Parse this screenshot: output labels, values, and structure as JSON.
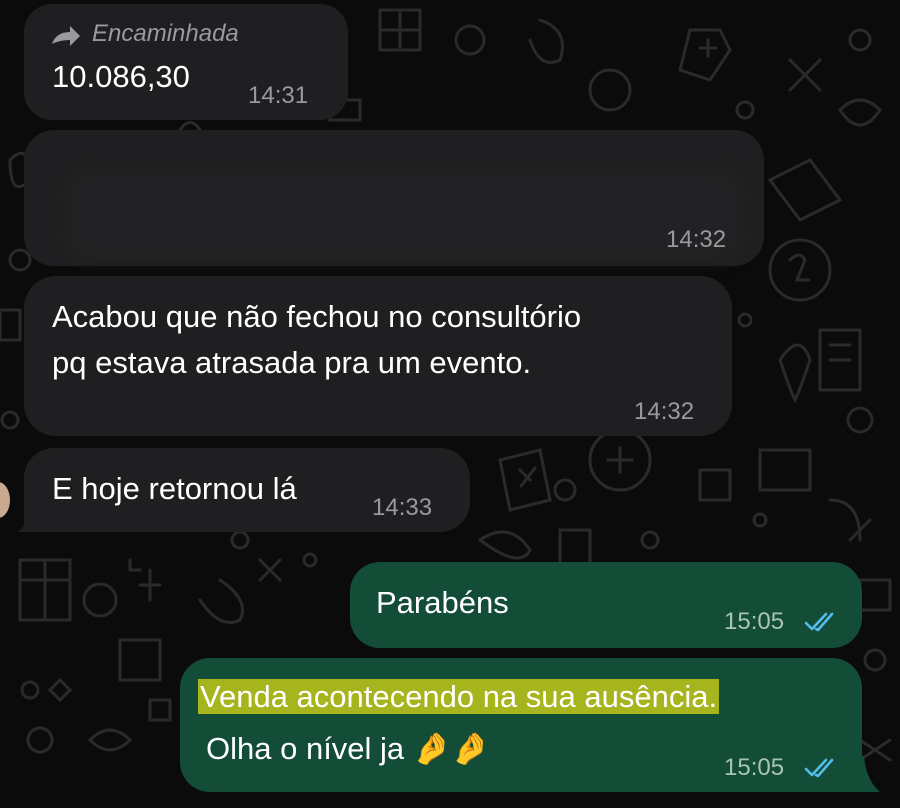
{
  "messages": [
    {
      "id": "m1",
      "direction": "incoming",
      "forwarded_label": "Encaminhada",
      "text": "10.086,30",
      "time": "14:31"
    },
    {
      "id": "m2",
      "direction": "incoming",
      "text": "",
      "time": "14:32"
    },
    {
      "id": "m3",
      "direction": "incoming",
      "lines": [
        "Acabou que não fechou no consultório",
        "pq estava atrasada pra um evento."
      ],
      "time": "14:32"
    },
    {
      "id": "m4",
      "direction": "incoming",
      "text": "E hoje retornou lá",
      "time": "14:33"
    },
    {
      "id": "m5",
      "direction": "outgoing",
      "text": "Parabéns",
      "time": "15:05",
      "status": "read"
    },
    {
      "id": "m6",
      "direction": "outgoing",
      "highlighted_line": "Venda acontecendo na sua ausência.",
      "line2": "Olha o nível ja",
      "emoji": "🤌🤌",
      "time": "15:05",
      "status": "read"
    }
  ],
  "colors": {
    "background": "#0b0b0b",
    "incoming_bubble": "#1f1f21",
    "outgoing_bubble": "#134d37",
    "read_ticks": "#53bdeb",
    "highlight": "#a6b51e"
  }
}
